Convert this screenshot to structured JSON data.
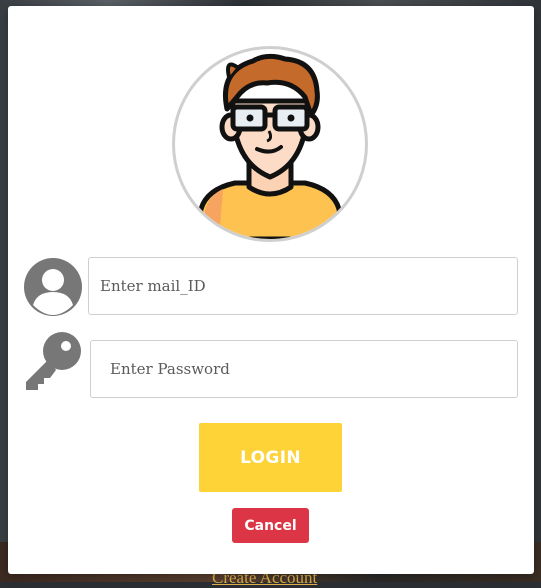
{
  "background": {
    "create_account_link": "Create Account"
  },
  "login_form": {
    "email": {
      "placeholder": "Enter mail_ID",
      "value": ""
    },
    "password": {
      "placeholder": "Enter Password",
      "value": ""
    },
    "login_label": "LOGIN",
    "cancel_label": "Cancel"
  },
  "icons": {
    "avatar": "user-avatar-illustration",
    "email": "user-circle-icon",
    "password": "key-icon"
  },
  "colors": {
    "login_button": "#fdd338",
    "cancel_button": "#dc3545",
    "icon_gray": "#777777"
  }
}
